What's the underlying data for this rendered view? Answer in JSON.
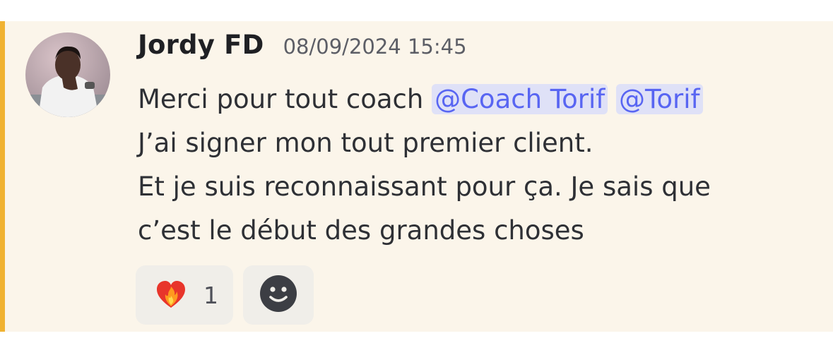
{
  "message": {
    "author": "Jordy FD",
    "timestamp": "08/09/2024 15:45",
    "line1_text": "Merci pour tout coach ",
    "mentions": [
      "@Coach Torif",
      "@Torif"
    ],
    "lines": [
      "J’ai signer mon tout premier client.",
      "Et je suis reconnaissant pour ça. Je sais que",
      "c’est le début des grandes choses"
    ],
    "reactions": [
      {
        "emoji": "heart-on-fire",
        "count": "1"
      }
    ],
    "add_reaction_icon": "smiley-icon"
  },
  "colors": {
    "highlight_bar": "#f0b232",
    "message_background": "#fbf5ea",
    "mention_text": "#5865f2",
    "mention_background": "#dfe1f7"
  }
}
